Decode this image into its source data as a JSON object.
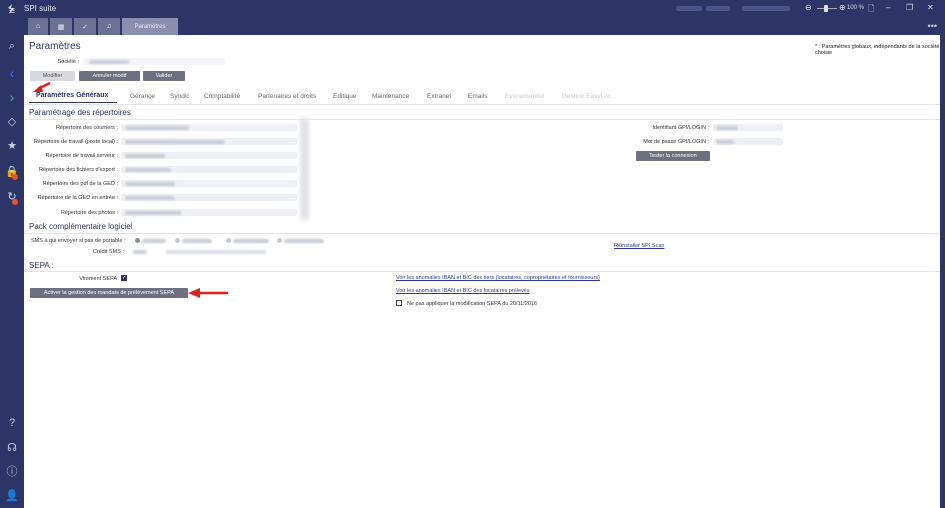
{
  "app": {
    "title": "SPI suite",
    "zoom": "100 %"
  },
  "toptabs": [
    {
      "icon": "home-icon"
    },
    {
      "icon": "calendar-icon"
    },
    {
      "icon": "check-icon"
    },
    {
      "icon": "bell-icon"
    },
    {
      "label": "Paramètres"
    }
  ],
  "page": {
    "title": "Paramètres",
    "note": "* : Paramètres globaux, indépendants de la société choisie",
    "societe_label": "Société :",
    "buttons": {
      "modifier": "Modifier",
      "annuler": "Annuler modif",
      "valider": "Valider"
    }
  },
  "tabs": [
    {
      "label": "Paramètres Généraux",
      "state": "active"
    },
    {
      "label": "Gérance",
      "state": "normal"
    },
    {
      "label": "Syndic",
      "state": "normal"
    },
    {
      "label": "Comptabilité",
      "state": "normal"
    },
    {
      "label": "Partenaires et droits",
      "state": "normal"
    },
    {
      "label": "Editique",
      "state": "normal"
    },
    {
      "label": "Maintenance",
      "state": "normal"
    },
    {
      "label": "Extranet",
      "state": "normal"
    },
    {
      "label": "Emails",
      "state": "normal"
    },
    {
      "label": "Evénementiel",
      "state": "disabled"
    },
    {
      "label": "Gestion EasyLoc",
      "state": "disabled"
    }
  ],
  "repertoires": {
    "title": "Paramétrage des répertoires",
    "fields": [
      "Répertoire des courriers :",
      "Répertoire de travail (poste local) :",
      "Répertoire de travail serveur :",
      "Répertoire des fichiers d'export :",
      "Répertoire des pdf de la GED :",
      "Répertoire de la GED en entrée :",
      "Répertoire des photos :"
    ],
    "gpi_login_label": "Identifiant GPI/LOGIN :",
    "gpi_password_label": "Mot de passe GPI/LOGIN :",
    "test_button": "Tester la connexion"
  },
  "pack": {
    "title": "Pack complémentaire logiciel",
    "sms_label": "SMS à qui envoyer si pas de portable :",
    "credit_label": "Crédit SMS :",
    "reinstall_link": "Réinstaller SPI Scan"
  },
  "sepa": {
    "title": "SEPA :",
    "virement_label": "Virement SEPA",
    "virement_checked": true,
    "activate_button": "Activer la gestion des mandats de prélèvement SEPA",
    "link_tiers": "Voir les anomalies IBAN et BIC des tiers (locataires, copropriétaires et fournisseurs)",
    "link_locataires": "Voir les anomalies IBAN et BIC des locataires prélevés",
    "no_modif_label": "Ne pas appliquer la modification SEPA du 20/11/2016",
    "no_modif_checked": false
  },
  "sidebar": [
    "search-icon",
    "chevron-left-icon",
    "chevron-right-icon",
    "diamond-icon",
    "star-icon",
    "lock-icon",
    "refresh-icon",
    "help-icon",
    "headset-icon",
    "info-icon",
    "user-icon"
  ],
  "colors": {
    "primary": "#2c3566",
    "button": "#6d7080",
    "link": "#2f3aa0",
    "arrow": "#e0201b"
  }
}
